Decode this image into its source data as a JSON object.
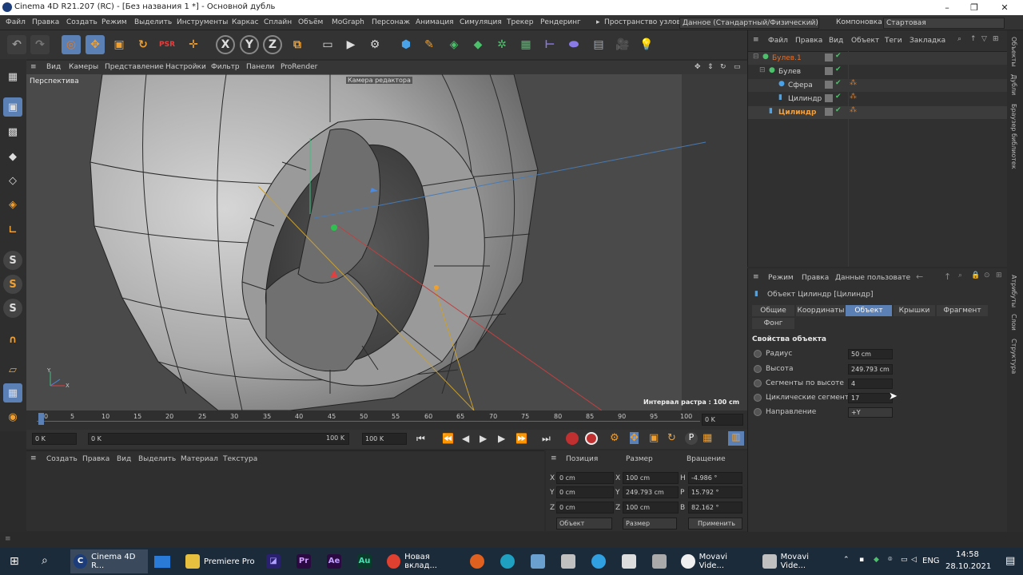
{
  "window": {
    "title": "Cinema 4D R21.207 (RC) - [Без названия 1 *] - Основной дубль"
  },
  "menu": [
    "Файл",
    "Правка",
    "Создать",
    "Режим",
    "Выделить",
    "Инструменты",
    "Каркас",
    "Сплайн",
    "Объём",
    "MoGraph",
    "Персонаж",
    "Анимация",
    "Симуляция",
    "Трекер",
    "Рендеринг"
  ],
  "node_space": {
    "label": "Пространство узлов:",
    "value": "Данное (Стандартный/Физический)"
  },
  "layout": {
    "label": "Компоновка",
    "value": "Стартовая"
  },
  "toolbar_letters": {
    "x": "X",
    "y": "Y",
    "z": "Z"
  },
  "viewport": {
    "menu": [
      "Вид",
      "Камеры",
      "Представление",
      "Настройки",
      "Фильтр",
      "Панели",
      "ProRender"
    ],
    "name": "Перспектива",
    "camera": "Камера редактора",
    "grid_interval": "Интервал растра : 100 cm"
  },
  "timeline": {
    "ticks": [
      "0",
      "5",
      "10",
      "15",
      "20",
      "25",
      "30",
      "35",
      "40",
      "45",
      "50",
      "55",
      "60",
      "65",
      "70",
      "75",
      "80",
      "85",
      "90",
      "95",
      "100"
    ],
    "frame": "0 K"
  },
  "transport": {
    "start": "0 K",
    "current": "0 K",
    "end_inner": "100 K",
    "end": "100 K"
  },
  "material_manager": {
    "menu": [
      "Создать",
      "Правка",
      "Вид",
      "Выделить",
      "Материал",
      "Текстура"
    ]
  },
  "coordinates": {
    "headers": {
      "position": "Позиция",
      "size": "Размер",
      "rotation": "Вращение"
    },
    "rows": [
      {
        "axis": "X",
        "pos": "0 cm",
        "size_axis": "X",
        "size": "100 cm",
        "rot_axis": "H",
        "rot": "-4.986 °"
      },
      {
        "axis": "Y",
        "pos": "0 cm",
        "size_axis": "Y",
        "size": "249.793 cm",
        "rot_axis": "P",
        "rot": "15.792 °"
      },
      {
        "axis": "Z",
        "pos": "0 cm",
        "size_axis": "Z",
        "size": "100 cm",
        "rot_axis": "B",
        "rot": "82.162 °"
      }
    ],
    "mode_select": "Объект",
    "size_select": "Размер",
    "apply": "Применить"
  },
  "object_manager": {
    "menu": [
      "Файл",
      "Правка",
      "Вид",
      "Объект",
      "Теги",
      "Закладка"
    ],
    "objects": [
      {
        "name": "Булев.1",
        "color": "#e07030"
      },
      {
        "name": "Булев",
        "color": "#d0d0d0"
      },
      {
        "name": "Сфера",
        "color": "#d0d0d0"
      },
      {
        "name": "Цилиндр",
        "color": "#d0d0d0"
      },
      {
        "name": "Цилиндр",
        "color": "#f0a040"
      }
    ]
  },
  "attributes": {
    "menu": [
      "Режим",
      "Правка",
      "Данные пользовате"
    ],
    "object_title": "Объект Цилиндр [Цилиндр]",
    "tabs": [
      "Общие",
      "Координаты",
      "Объект",
      "Крышки",
      "Фрагмент",
      "Фонг"
    ],
    "active_tab": "Объект",
    "section": "Свойства объекта",
    "props": [
      {
        "label": "Радиус",
        "value": "50 cm"
      },
      {
        "label": "Высота",
        "value": "249.793 cm"
      },
      {
        "label": "Сегменты по высоте",
        "value": "4"
      },
      {
        "label": "Циклические сегменты",
        "value": "17"
      },
      {
        "label": "Направление",
        "value": "+Y"
      }
    ]
  },
  "right_strip": [
    "Объекты",
    "Дубли",
    "Браузер библиотек",
    "Атрибуты",
    "Слои",
    "Структура"
  ],
  "taskbar": {
    "apps": [
      "Cinema 4D R...",
      "Premiere Pro",
      "Новая вклад...",
      "Movavi Vide...",
      "Movavi Vide..."
    ],
    "lang": "ENG",
    "time": "14:58",
    "date": "28.10.2021"
  },
  "colors": {
    "accent": "#5b80b6",
    "orange": "#e07a20"
  }
}
